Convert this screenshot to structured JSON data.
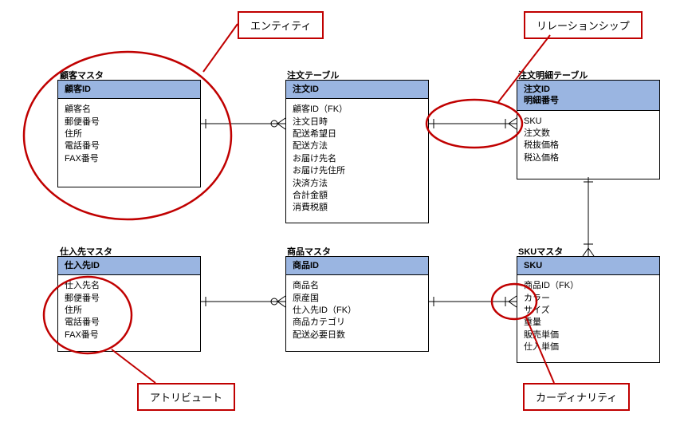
{
  "annotations": {
    "entity": "エンティティ",
    "relationship": "リレーションシップ",
    "attribute": "アトリビュート",
    "cardinality": "カーディナリティ"
  },
  "entities": {
    "customer": {
      "title": "顧客マスタ",
      "pk": "顧客ID",
      "attrs": [
        "顧客名",
        "郵便番号",
        "住所",
        "電話番号",
        "FAX番号"
      ]
    },
    "order": {
      "title": "注文テーブル",
      "pk": "注文ID",
      "attrs": [
        "顧客ID（FK）",
        "注文日時",
        "配送希望日",
        "配送方法",
        "お届け先名",
        "お届け先住所",
        "決済方法",
        "合計金額",
        "消費税額"
      ]
    },
    "orderDetail": {
      "title": "注文明細テーブル",
      "pk1": "注文ID",
      "pk2": "明細番号",
      "attrs": [
        "SKU",
        "注文数",
        "税抜価格",
        "税込価格"
      ]
    },
    "supplier": {
      "title": "仕入先マスタ",
      "pk": "仕入先ID",
      "attrs": [
        "仕入先名",
        "郵便番号",
        "住所",
        "電話番号",
        "FAX番号"
      ]
    },
    "product": {
      "title": "商品マスタ",
      "pk": "商品ID",
      "attrs": [
        "商品名",
        "原産国",
        "仕入先ID（FK）",
        "商品カテゴリ",
        "配送必要日数"
      ]
    },
    "sku": {
      "title": "SKUマスタ",
      "pk": "SKU",
      "attrs": [
        "商品ID（FK）",
        "カラー",
        "サイズ",
        "重量",
        "販売単価",
        "仕入単価"
      ]
    }
  }
}
